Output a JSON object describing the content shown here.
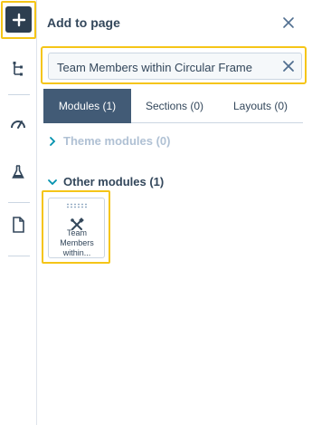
{
  "rail": {
    "add_label": "+",
    "icons": [
      "add-icon",
      "tree-icon",
      "gauge-icon",
      "flask-icon",
      "document-icon"
    ]
  },
  "panel": {
    "title": "Add to page",
    "search": {
      "value": "Team Members within Circular Frame"
    },
    "tabs": [
      {
        "label": "Modules (1)",
        "active": true
      },
      {
        "label": "Sections (0)",
        "active": false
      },
      {
        "label": "Layouts (0)",
        "active": false
      }
    ],
    "theme_modules_label": "Theme modules (0)",
    "other_modules_label": "Other modules (1)",
    "modules": [
      {
        "line1": "Team",
        "line2": "Members",
        "line3": "within..."
      }
    ]
  },
  "colors": {
    "highlight": "#f5c518",
    "active_tab": "#425b76",
    "dark_button": "#2d3e50",
    "text": "#33475b",
    "muted_text": "#b0c1d4",
    "teal": "#0091ae"
  }
}
